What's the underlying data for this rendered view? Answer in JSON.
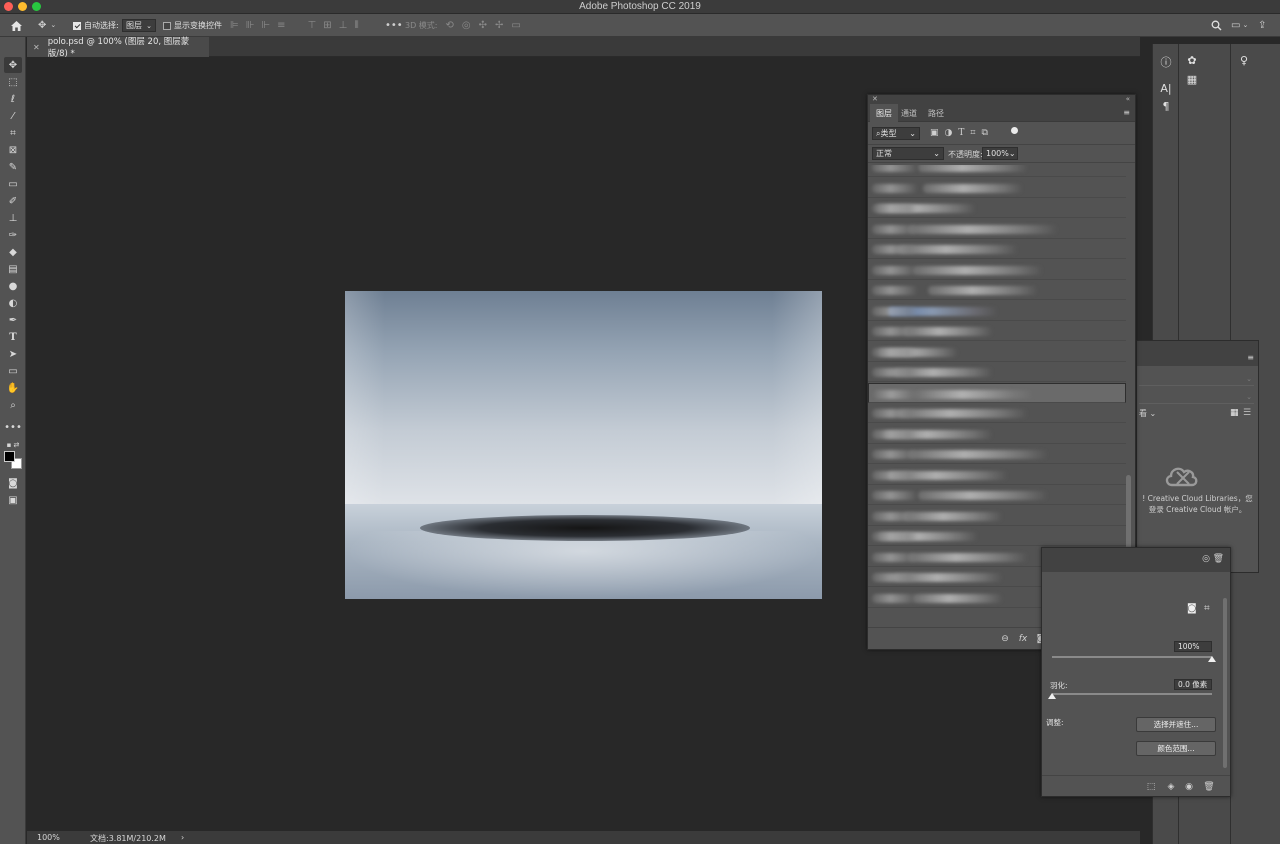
{
  "app": {
    "title": "Adobe Photoshop CC 2019"
  },
  "options_bar": {
    "auto_select_label": "自动选择:",
    "auto_select_target": "图层",
    "show_transform_label": "显示变换控件",
    "mode_3d_label": "3D 模式:"
  },
  "document": {
    "tab_title": "polo.psd @ 100% (图层 20, 图层蒙版/8) *"
  },
  "status": {
    "zoom": "100%",
    "doc_size": "文档:3.81M/210.2M",
    "arrow": "›"
  },
  "layers_panel": {
    "tabs": [
      "图层",
      "通道",
      "路径"
    ],
    "filter_kind": "类型",
    "blend_mode": "正常",
    "opacity_label": "不透明度:",
    "opacity_value": "100%"
  },
  "libraries_panel": {
    "view_label": "看",
    "message_line1": "! Creative Cloud Libraries，您",
    "message_line2": "登录 Creative Cloud 帐户。"
  },
  "properties_panel": {
    "density_value": "100%",
    "density_level": 1.0,
    "feather_label": "羽化:",
    "feather_value": "0.0 像素",
    "feather_level": 0.0,
    "adjust_label": "调整:",
    "select_mask_button": "选择并遮住...",
    "color_range_button": "颜色范围..."
  },
  "icons": {
    "home": "home-icon",
    "move": "move-icon",
    "search": "search-icon",
    "workspace": "workspace-icon",
    "info": "info-icon",
    "character": "character-icon",
    "paragraph": "paragraph-icon",
    "color": "color-icon",
    "swatches": "swatches-icon",
    "learn": "lightbulb-icon"
  },
  "colors": {
    "ui_dark": "#282828",
    "panel": "#535353",
    "traffic_red": "#fe5f57",
    "traffic_yellow": "#febc2e",
    "traffic_green": "#28c840"
  }
}
